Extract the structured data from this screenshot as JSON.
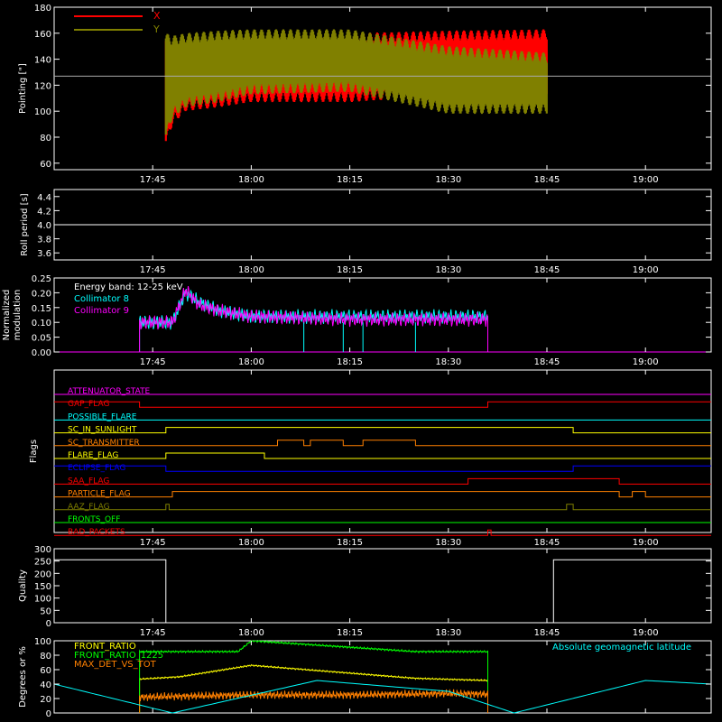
{
  "colors": {
    "x": "#ff0000",
    "y": "#808000",
    "cyan": "#00ffff",
    "magenta": "#ff00ff",
    "yellow": "#ffff00",
    "green": "#00ff00",
    "orange": "#ff8000",
    "white": "#ffffff",
    "blue": "#0000ff",
    "olive": "#808000",
    "red": "#ff0000"
  },
  "time_ticks": [
    "17:45",
    "18:00",
    "18:15",
    "18:30",
    "18:45",
    "19:00"
  ],
  "chart_data": [
    {
      "id": "pointing",
      "type": "line",
      "ylabel": "Pointing [\"]",
      "ylim": [
        55,
        180
      ],
      "yticks": [
        60,
        80,
        100,
        120,
        140,
        160,
        180
      ],
      "reference_line": 127,
      "legend": [
        "X",
        "Y"
      ],
      "series": [
        {
          "name": "X",
          "x": [
            "17:47",
            "17:48",
            "17:50",
            "17:55",
            "18:00",
            "18:15",
            "18:30",
            "18:45"
          ],
          "max": [
            158,
            150,
            145,
            152,
            157,
            160,
            162,
            163
          ],
          "min": [
            73,
            90,
            100,
            103,
            107,
            107,
            112,
            113
          ]
        },
        {
          "name": "Y",
          "x": [
            "17:47",
            "17:48",
            "17:50",
            "17:55",
            "18:00",
            "18:15",
            "18:30",
            "18:45"
          ],
          "max": [
            160,
            158,
            160,
            162,
            163,
            163,
            150,
            145
          ],
          "min": [
            78,
            95,
            103,
            107,
            113,
            115,
            98,
            98
          ]
        }
      ]
    },
    {
      "id": "roll",
      "type": "line",
      "ylabel": "Roll period [s]",
      "ylim": [
        3.5,
        4.5
      ],
      "yticks": [
        3.6,
        3.8,
        4.0,
        4.2,
        4.4
      ],
      "series": [
        {
          "name": "",
          "x": [
            "17:30",
            "19:10"
          ],
          "values": [
            4.0,
            4.0
          ]
        }
      ]
    },
    {
      "id": "modulation",
      "type": "line",
      "ylabel": "Normalized modulation",
      "ylim": [
        0,
        0.25
      ],
      "yticks": [
        0.0,
        0.05,
        0.1,
        0.15,
        0.2,
        0.25
      ],
      "annotation": "Energy band: 12-25 keV",
      "legend": [
        "Collimator 8",
        "Collimator 9"
      ],
      "series": [
        {
          "name": "Collimator 8",
          "x": [
            "17:43",
            "17:48",
            "17:50",
            "17:52",
            "17:55",
            "18:00",
            "18:15",
            "18:30",
            "18:36"
          ],
          "values": [
            0.1,
            0.1,
            0.2,
            0.17,
            0.14,
            0.12,
            0.12,
            0.12,
            0.12
          ]
        },
        {
          "name": "Collimator 9",
          "x": [
            "17:43",
            "17:48",
            "17:50",
            "17:52",
            "17:55",
            "18:00",
            "18:15",
            "18:30",
            "18:36"
          ],
          "values": [
            0.1,
            0.1,
            0.21,
            0.16,
            0.14,
            0.12,
            0.11,
            0.11,
            0.11
          ]
        }
      ]
    },
    {
      "id": "flags",
      "type": "line",
      "ylabel": "Flags",
      "series": [
        {
          "name": "ATTENUATOR_STATE",
          "color": "#ff00ff",
          "steps": [
            [
              "17:30",
              0
            ]
          ]
        },
        {
          "name": "GAP_FLAG",
          "color": "#ff0000",
          "steps": [
            [
              "17:30",
              1
            ],
            [
              "17:43",
              0
            ],
            [
              "18:36",
              1
            ]
          ]
        },
        {
          "name": "POSSIBLE_FLARE",
          "color": "#00ffff",
          "steps": [
            [
              "17:30",
              0
            ]
          ]
        },
        {
          "name": "SC_IN_SUNLIGHT",
          "color": "#ffff00",
          "steps": [
            [
              "17:30",
              0
            ],
            [
              "17:47",
              1
            ],
            [
              "18:49",
              0
            ]
          ]
        },
        {
          "name": "SC_TRANSMITTER",
          "color": "#ff8000",
          "steps": [
            [
              "17:30",
              0
            ],
            [
              "18:04",
              1
            ],
            [
              "18:08",
              0
            ],
            [
              "18:09",
              1
            ],
            [
              "18:14",
              0
            ],
            [
              "18:17",
              1
            ],
            [
              "18:25",
              0
            ]
          ]
        },
        {
          "name": "FLARE_FLAG",
          "color": "#ffff00",
          "steps": [
            [
              "17:30",
              0
            ],
            [
              "17:47",
              1
            ],
            [
              "18:02",
              0
            ]
          ]
        },
        {
          "name": "ECLIPSE_FLAG",
          "color": "#0000ff",
          "steps": [
            [
              "17:30",
              1
            ],
            [
              "17:47",
              0
            ],
            [
              "18:49",
              1
            ]
          ]
        },
        {
          "name": "SAA_FLAG",
          "color": "#ff0000",
          "steps": [
            [
              "17:30",
              0
            ],
            [
              "18:33",
              1
            ],
            [
              "18:56",
              0
            ]
          ]
        },
        {
          "name": "PARTICLE_FLAG",
          "color": "#ff8000",
          "steps": [
            [
              "17:30",
              0
            ],
            [
              "17:48",
              1
            ],
            [
              "18:56",
              0
            ],
            [
              "18:58",
              1
            ],
            [
              "19:00",
              0
            ]
          ]
        },
        {
          "name": "AAZ_FLAG",
          "color": "#808000",
          "steps": [
            [
              "17:30",
              0
            ],
            [
              "17:47",
              1
            ],
            [
              "17:47:30",
              0
            ],
            [
              "18:48",
              1
            ],
            [
              "18:49",
              0
            ]
          ]
        },
        {
          "name": "FRONTS_OFF",
          "color": "#00ff00",
          "steps": [
            [
              "17:30",
              0
            ]
          ]
        },
        {
          "name": "BAD_PACKETS",
          "color": "#ff0000",
          "steps": [
            [
              "17:30",
              0
            ],
            [
              "18:36",
              1
            ],
            [
              "18:36:30",
              0
            ]
          ]
        }
      ]
    },
    {
      "id": "quality",
      "type": "line",
      "ylabel": "Quality",
      "ylim": [
        0,
        300
      ],
      "yticks": [
        0,
        50,
        100,
        150,
        200,
        250,
        300
      ],
      "series": [
        {
          "name": "",
          "x": [
            "17:30",
            "17:47",
            "17:47",
            "18:46",
            "18:46",
            "19:10"
          ],
          "values": [
            255,
            255,
            0,
            0,
            255,
            255
          ]
        }
      ]
    },
    {
      "id": "ratios",
      "type": "line",
      "ylabel": "Degrees or %",
      "ylim": [
        0,
        100
      ],
      "yticks": [
        0,
        20,
        40,
        60,
        80,
        100
      ],
      "annotation": "Absolute geomagnetic latitude",
      "legend": [
        "FRONT_RATIO",
        "FRONT_RATIO_1225",
        "MAX_DET_VS_TOT"
      ],
      "series": [
        {
          "name": "FRONT_RATIO",
          "x": [
            "17:43",
            "17:49",
            "18:00",
            "18:25",
            "18:36"
          ],
          "values": [
            47,
            50,
            66,
            48,
            45
          ]
        },
        {
          "name": "FRONT_RATIO_1225",
          "x": [
            "17:43",
            "17:58",
            "18:00",
            "18:25",
            "18:36"
          ],
          "values": [
            85,
            85,
            100,
            85,
            85
          ]
        },
        {
          "name": "MAX_DET_VS_TOT",
          "x": [
            "17:43",
            "18:00",
            "18:15",
            "18:30",
            "18:36"
          ],
          "values": [
            22,
            25,
            25,
            27,
            26
          ]
        },
        {
          "name": "Absolute geomagnetic latitude",
          "x": [
            "17:30",
            "17:48",
            "18:10",
            "18:30",
            "18:40",
            "19:00",
            "19:10"
          ],
          "values": [
            40,
            0,
            45,
            30,
            0,
            45,
            40
          ]
        }
      ]
    }
  ]
}
